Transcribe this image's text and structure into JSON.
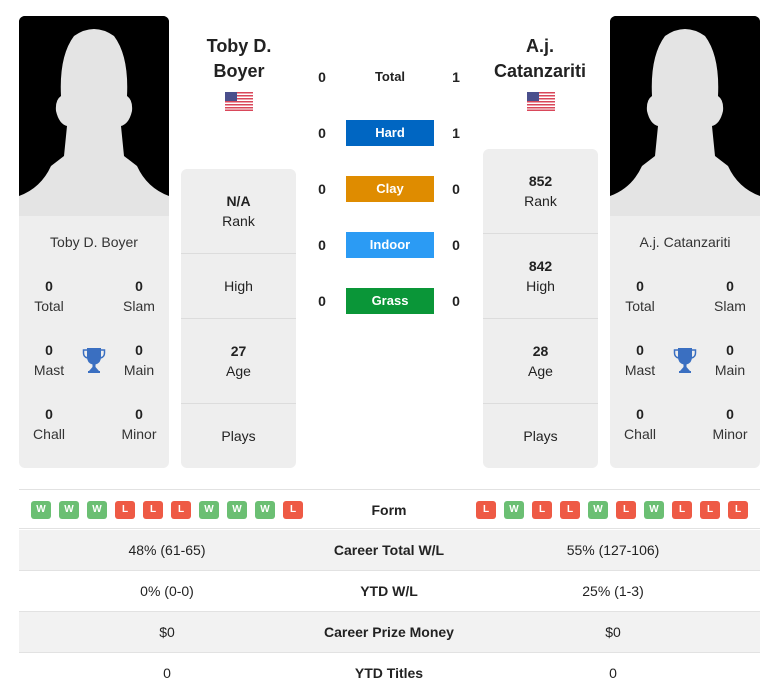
{
  "player_left": {
    "name": "Toby D. Boyer",
    "name_line1": "Toby D.",
    "name_line2": "Boyer",
    "country_flag": "us-flag-icon",
    "titles": {
      "total": {
        "value": "0",
        "label": "Total"
      },
      "slam": {
        "value": "0",
        "label": "Slam"
      },
      "mast": {
        "value": "0",
        "label": "Mast"
      },
      "main": {
        "value": "0",
        "label": "Main"
      },
      "chall": {
        "value": "0",
        "label": "Chall"
      },
      "minor": {
        "value": "0",
        "label": "Minor"
      }
    },
    "info": {
      "rank": {
        "value": "N/A",
        "label": "Rank"
      },
      "high": {
        "value": "",
        "label": "High"
      },
      "age": {
        "value": "27",
        "label": "Age"
      },
      "plays": {
        "value": "",
        "label": "Plays"
      }
    },
    "form": [
      "W",
      "W",
      "W",
      "L",
      "L",
      "L",
      "W",
      "W",
      "W",
      "L"
    ]
  },
  "player_right": {
    "name": "A.j. Catanzariti",
    "name_line1": "A.j.",
    "name_line2": "Catanzariti",
    "country_flag": "us-flag-icon",
    "titles": {
      "total": {
        "value": "0",
        "label": "Total"
      },
      "slam": {
        "value": "0",
        "label": "Slam"
      },
      "mast": {
        "value": "0",
        "label": "Mast"
      },
      "main": {
        "value": "0",
        "label": "Main"
      },
      "chall": {
        "value": "0",
        "label": "Chall"
      },
      "minor": {
        "value": "0",
        "label": "Minor"
      }
    },
    "info": {
      "rank": {
        "value": "852",
        "label": "Rank"
      },
      "high": {
        "value": "842",
        "label": "High"
      },
      "age": {
        "value": "28",
        "label": "Age"
      },
      "plays": {
        "value": "",
        "label": "Plays"
      }
    },
    "form": [
      "L",
      "W",
      "L",
      "L",
      "W",
      "L",
      "W",
      "L",
      "L",
      "L"
    ]
  },
  "h2h": [
    {
      "label": "Total",
      "left": "0",
      "right": "1",
      "color": ""
    },
    {
      "label": "Hard",
      "left": "0",
      "right": "1",
      "color": "#0066c2"
    },
    {
      "label": "Clay",
      "left": "0",
      "right": "0",
      "color": "#df8c00"
    },
    {
      "label": "Indoor",
      "left": "0",
      "right": "0",
      "color": "#2b9bf4"
    },
    {
      "label": "Grass",
      "left": "0",
      "right": "0",
      "color": "#0a9638"
    }
  ],
  "form_label": "Form",
  "stats": [
    {
      "label": "Career Total W/L",
      "left": "48% (61-65)",
      "right": "55% (127-106)"
    },
    {
      "label": "YTD W/L",
      "left": "0% (0-0)",
      "right": "25% (1-3)"
    },
    {
      "label": "Career Prize Money",
      "left": "$0",
      "right": "$0"
    },
    {
      "label": "YTD Titles",
      "left": "0",
      "right": "0"
    }
  ]
}
